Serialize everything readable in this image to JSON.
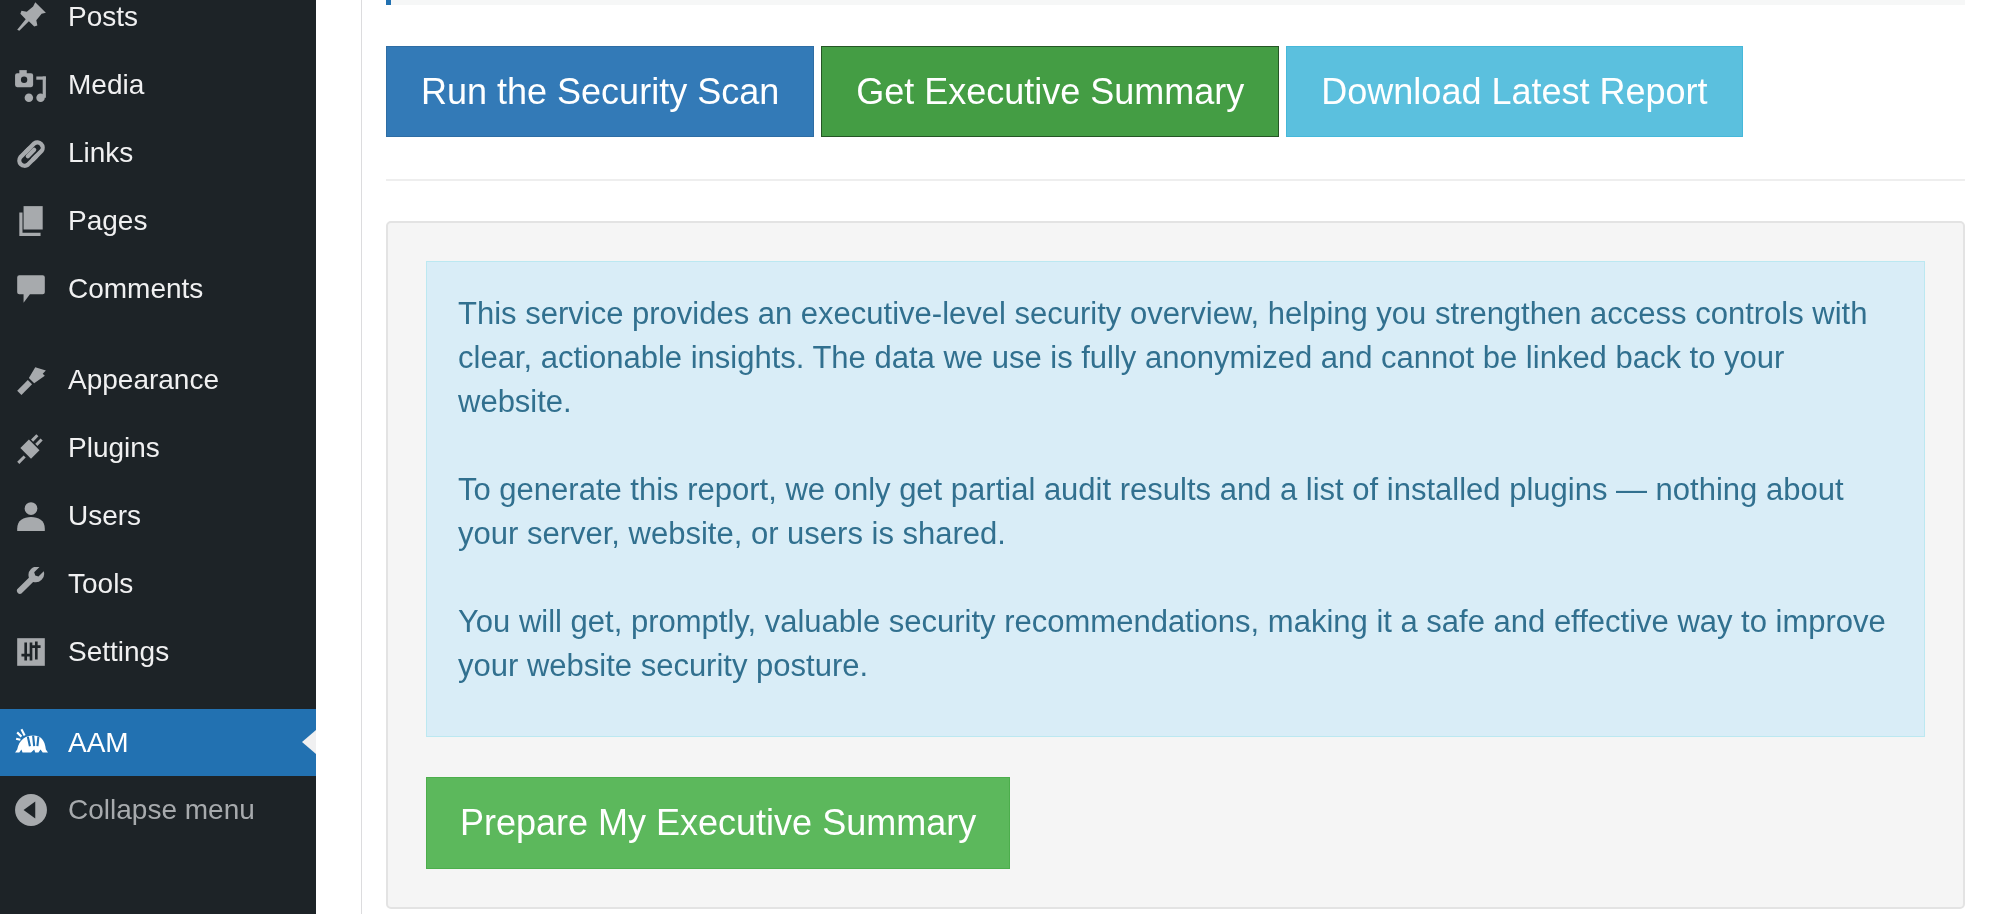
{
  "sidebar": {
    "groups": [
      [
        {
          "label": "Posts",
          "selected": false
        },
        {
          "label": "Media",
          "selected": false
        },
        {
          "label": "Links",
          "selected": false
        },
        {
          "label": "Pages",
          "selected": false
        },
        {
          "label": "Comments",
          "selected": false
        }
      ],
      [
        {
          "label": "Appearance",
          "selected": false
        },
        {
          "label": "Plugins",
          "selected": false
        },
        {
          "label": "Users",
          "selected": false
        },
        {
          "label": "Tools",
          "selected": false
        },
        {
          "label": "Settings",
          "selected": false
        }
      ],
      [
        {
          "label": "AAM",
          "selected": true
        }
      ]
    ],
    "collapse": {
      "label": "Collapse menu"
    }
  },
  "toolbar": {
    "buttons": [
      {
        "label": "Run the Security Scan",
        "kind": "primary",
        "selected": false
      },
      {
        "label": "Get Executive Summary",
        "kind": "success",
        "selected": true
      },
      {
        "label": "Download Latest Report",
        "kind": "info",
        "selected": false
      }
    ]
  },
  "panel": {
    "notice": [
      "This service provides an executive-level security overview, helping you strengthen access controls with clear, actionable insights. The data we use is fully anonymized and cannot be linked back to your website.",
      "To generate this report, we only get partial audit results and a list of installed plugins — nothing about your server, website, or users is shared.",
      "You will get, promptly, valuable security recommendations, making it a safe and effective way to improve your website security posture."
    ],
    "button": {
      "label": "Prepare My Executive Summary",
      "kind": "success"
    }
  }
}
